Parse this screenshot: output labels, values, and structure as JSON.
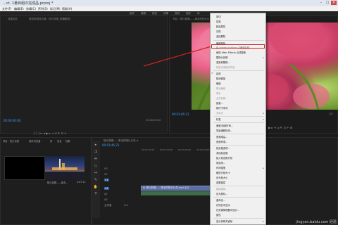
{
  "titlebar": {
    "title": "…ct. 1番目組の完成品.prproj *",
    "min": "–",
    "max": "□",
    "close": "✕"
  },
  "menubar": {
    "items": [
      "文件(F)",
      "编辑(E)",
      "剪辑(C)",
      "序列(S)",
      "标记(M)",
      "帮助(H)"
    ]
  },
  "workspace": {
    "tabs": [
      "组件",
      "编辑",
      "颜色",
      "效果",
      "音频",
      "图形",
      "库"
    ]
  },
  "source": {
    "tabs": [
      "效果控件",
      "音频剪辑混合器：短片剪辑_视频1",
      "元数据"
    ],
    "timecode_left": "00:00:00:00",
    "timecode_right": "00:00:00:00",
    "transport": "{ } | ⇤ ◂ ▶ ▸ ⇥ ⇲ ⇱ ⊡ +"
  },
  "program": {
    "tab": "节目：短片剪辑——单击的短片片先 ≡",
    "timecode": "00:03:46:21",
    "fit": "1/2",
    "transport": "▶ ▸ ⇥ ⇲ ⇱ ⊡ + ⊞"
  },
  "project": {
    "tabs": [
      "项目：短片剪辑",
      "媒体浏览器",
      "库",
      "信息",
      "效果"
    ],
    "clips": [
      {
        "name": "短片剪辑——单击…",
        "duration": "4:07:11"
      }
    ]
  },
  "timeline": {
    "tab": "短片剪辑——单击的短片片先 ≡",
    "timecode": "00:03:46:21",
    "ruler": [
      "00:02:00:00",
      "00:02:30:00",
      "00:03:00:00",
      "00:03:30:00",
      "00:04:00:00"
    ],
    "tracks": [
      "V3",
      "V2",
      "V1",
      "A1",
      "A2",
      "A3",
      "主声道"
    ],
    "clip_label": "fx 短片剪辑——单击的短片片先.mp4 [V]",
    "master_value": "0.0"
  },
  "context_menu": {
    "items": [
      {
        "label": "剪切",
        "disabled": false
      },
      {
        "label": "复制",
        "disabled": false
      },
      {
        "label": "粘贴属性",
        "disabled": false
      },
      {
        "label": "清除",
        "disabled": false
      },
      {
        "label": "波纹删除",
        "disabled": false
      },
      {
        "label": "编辑原始",
        "disabled": false
      },
      {
        "label": "在 Adobe Audition 中编辑剪辑",
        "disabled": false,
        "highlight": true
      },
      {
        "label": "使用 After Effects 合成替换",
        "disabled": false
      },
      {
        "label": "替换为剪辑",
        "disabled": false,
        "submenu": true
      },
      {
        "label": "渲染和替换...",
        "disabled": false
      },
      {
        "label": "恢复未渲染的内容",
        "disabled": true
      },
      {
        "label": "启用",
        "disabled": false,
        "checked": true
      },
      {
        "label": "取消链接",
        "disabled": false
      },
      {
        "label": "编组",
        "disabled": false
      },
      {
        "label": "取消编组",
        "disabled": true
      },
      {
        "label": "同步",
        "disabled": true
      },
      {
        "label": "合并剪辑...",
        "disabled": true
      },
      {
        "label": "嵌套...",
        "disabled": false
      },
      {
        "label": "制作子序列",
        "disabled": false
      },
      {
        "label": "多机位",
        "disabled": true,
        "submenu": true
      },
      {
        "label": "标签",
        "disabled": false,
        "submenu": true
      },
      {
        "label": "速度/持续时间...",
        "disabled": false
      },
      {
        "label": "场景编辑检测...",
        "disabled": false
      },
      {
        "label": "音频增益...",
        "disabled": false
      },
      {
        "label": "音频声道...",
        "disabled": false
      },
      {
        "label": "帧定格选项...",
        "disabled": false
      },
      {
        "label": "添加帧定格",
        "disabled": false
      },
      {
        "label": "插入帧定格分段",
        "disabled": false
      },
      {
        "label": "场选项...",
        "disabled": false
      },
      {
        "label": "时间插值",
        "disabled": false,
        "submenu": true
      },
      {
        "label": "缩放为帧大小",
        "disabled": false
      },
      {
        "label": "设为帧大小",
        "disabled": false
      },
      {
        "label": "调整图层",
        "disabled": false
      },
      {
        "label": "链接媒体...",
        "disabled": true
      },
      {
        "label": "设为脱机...",
        "disabled": false
      },
      {
        "label": "重命名...",
        "disabled": false
      },
      {
        "label": "在项目中显示",
        "disabled": false
      },
      {
        "label": "在资源管理器中显示...",
        "disabled": false
      },
      {
        "label": "属性",
        "disabled": false
      },
      {
        "label": "显示剪辑关键帧",
        "disabled": false,
        "submenu": true
      }
    ]
  },
  "watermark": "jingyan.baidu.com 经验",
  "colors": {
    "timecode": "#3ea1ff",
    "highlight_border": "#d32020",
    "menu_bg": "#f0f0f0",
    "clip_video": "#5b6fa6"
  }
}
